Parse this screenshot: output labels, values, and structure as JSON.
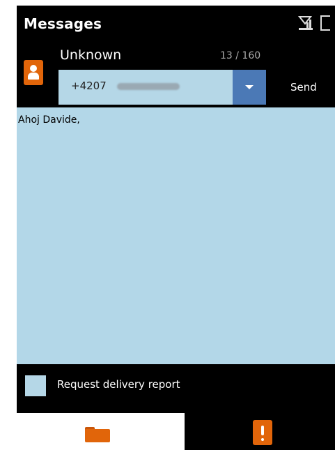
{
  "header": {
    "title": "Messages"
  },
  "compose": {
    "recipient_name": "Unknown",
    "char_counter": "13 / 160",
    "recipient_number": "+4207",
    "send_label": "Send"
  },
  "message": {
    "body": "Ahoj Davide,"
  },
  "options": {
    "delivery_report_label": "Request delivery report",
    "delivery_report_checked": false
  },
  "tabs": [
    {
      "icon": "folder-icon"
    },
    {
      "icon": "alert-icon"
    }
  ],
  "colors": {
    "accent": "#e1650a",
    "field_bg": "#b5d7e7",
    "dropdown_bg": "#4b79b6"
  }
}
